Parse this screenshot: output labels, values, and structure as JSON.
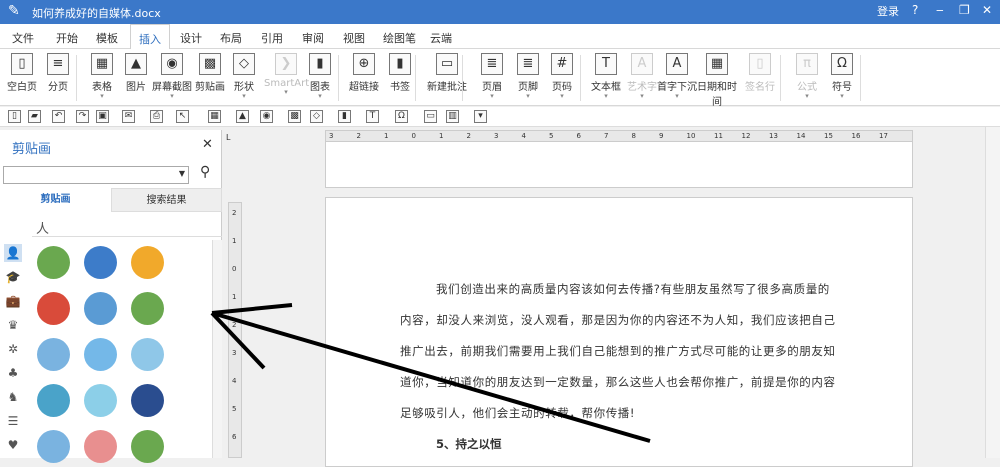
{
  "window": {
    "title": "如何养成好的自媒体.docx",
    "login": "登录",
    "help": "?",
    "minimize": "‒",
    "restore": "❐",
    "close": "✕"
  },
  "tabs": [
    "文件",
    "开始",
    "模板",
    "插入",
    "设计",
    "布局",
    "引用",
    "审阅",
    "视图",
    "绘图笔",
    "云端"
  ],
  "active_tab": "插入",
  "ribbon": [
    {
      "label": "空白页",
      "icon": "blank-page-icon",
      "glyph": "▯"
    },
    {
      "label": "分页",
      "icon": "page-break-icon",
      "glyph": "≡"
    },
    {
      "label": "表格",
      "icon": "table-icon",
      "glyph": "▦"
    },
    {
      "label": "图片",
      "icon": "picture-icon",
      "glyph": "▲"
    },
    {
      "label": "屏幕截图",
      "icon": "screenshot-icon",
      "glyph": "◉"
    },
    {
      "label": "剪贴画",
      "icon": "clipart-icon",
      "glyph": "▩"
    },
    {
      "label": "形状",
      "icon": "shapes-icon",
      "glyph": "◇"
    },
    {
      "label": "SmartArt",
      "icon": "smartart-icon",
      "glyph": "❯"
    },
    {
      "label": "图表",
      "icon": "chart-icon",
      "glyph": "▮"
    },
    {
      "label": "超链接",
      "icon": "hyperlink-icon",
      "glyph": "⊕"
    },
    {
      "label": "书签",
      "icon": "bookmark-icon",
      "glyph": "▮"
    },
    {
      "label": "新建批注",
      "icon": "comment-icon",
      "glyph": "▭"
    },
    {
      "label": "页眉",
      "icon": "header-icon",
      "glyph": "≣"
    },
    {
      "label": "页脚",
      "icon": "footer-icon",
      "glyph": "≣"
    },
    {
      "label": "页码",
      "icon": "page-number-icon",
      "glyph": "#"
    },
    {
      "label": "文本框",
      "icon": "textbox-icon",
      "glyph": "T"
    },
    {
      "label": "艺术字",
      "icon": "wordart-icon",
      "glyph": "A"
    },
    {
      "label": "首字下沉",
      "icon": "dropcap-icon",
      "glyph": "A"
    },
    {
      "label": "日期和时间",
      "icon": "datetime-icon",
      "glyph": "▦"
    },
    {
      "label": "签名行",
      "icon": "signature-line-icon",
      "glyph": "▯"
    },
    {
      "label": "公式",
      "icon": "equation-icon",
      "glyph": "π"
    },
    {
      "label": "符号",
      "icon": "symbol-icon",
      "glyph": "Ω"
    }
  ],
  "panel": {
    "title": "剪贴画",
    "close": "✕",
    "search_value": "",
    "tabs": [
      "剪贴画",
      "搜索结果"
    ],
    "category": "人"
  },
  "ruler": [
    "3",
    "2",
    "1",
    "0",
    "1",
    "2",
    "3",
    "4",
    "5",
    "6",
    "7",
    "8",
    "9",
    "10",
    "11",
    "12",
    "13",
    "14",
    "15",
    "16",
    "17"
  ],
  "vruler": [
    "2",
    "1",
    "0",
    "1",
    "2",
    "3",
    "4",
    "5",
    "6"
  ],
  "document": {
    "paragraph": "我们创造出来的高质量内容该如何去传播?有些朋友虽然写了很多高质量的内容，却没人来浏览，没人观看，那是因为你的内容还不为人知，我们应该把自己推广出去，前期我们需要用上我们自己能想到的推广方式尽可能的让更多的朋友知道你，当知道你的朋友达到一定数量，那么这些人也会帮你推广，前提是你的内容足够吸引人，他们会主动的转载，帮你传播!",
    "heading": "5、持之以恒"
  },
  "colors": {
    "title_bar": "#3b78c9",
    "accent": "#2f6fbf"
  }
}
